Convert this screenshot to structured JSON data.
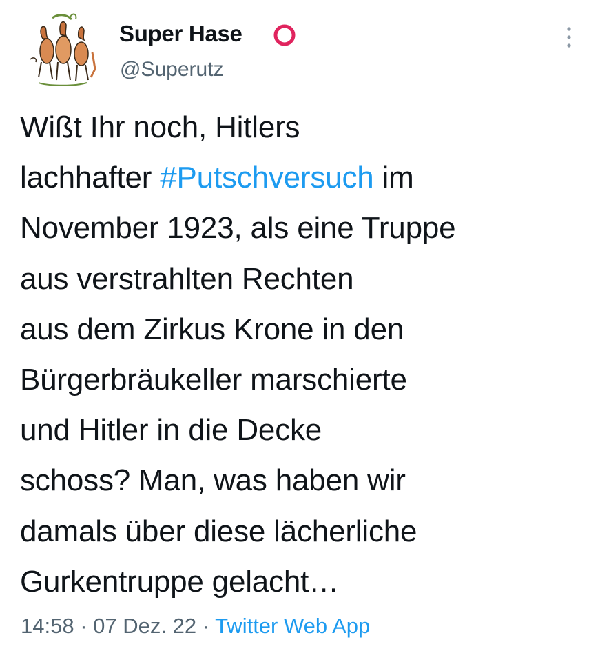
{
  "author": {
    "display_name": "Super Hase",
    "handle": "@Superutz",
    "badge_icon": "red-ring-icon",
    "badge_color": "#e0245e"
  },
  "menu": {
    "more_icon": "more-vertical-icon"
  },
  "tweet": {
    "lines": [
      {
        "text": "Wißt Ihr noch, Hitlers"
      },
      {
        "before": "lachhafter ",
        "hashtag": "#Putschversuch",
        "after": " im"
      },
      {
        "text": "November 1923, als eine Truppe"
      },
      {
        "text": "aus verstrahlten Rechten"
      },
      {
        "text": "aus dem Zirkus Krone in den"
      },
      {
        "text": "Bürgerbräukeller marschierte"
      },
      {
        "text": "und Hitler in die Decke"
      },
      {
        "text": "schoss? Man, was haben wir"
      },
      {
        "text": "damals über diese lächerliche"
      },
      {
        "text": "Gurkentruppe gelacht…"
      }
    ]
  },
  "meta": {
    "time": "14:58",
    "separator": " · ",
    "date": "07 Dez. 22",
    "source": "Twitter Web App"
  },
  "colors": {
    "link": "#1d9bf0",
    "secondary_text": "#536471",
    "primary_text": "#0f1419"
  }
}
